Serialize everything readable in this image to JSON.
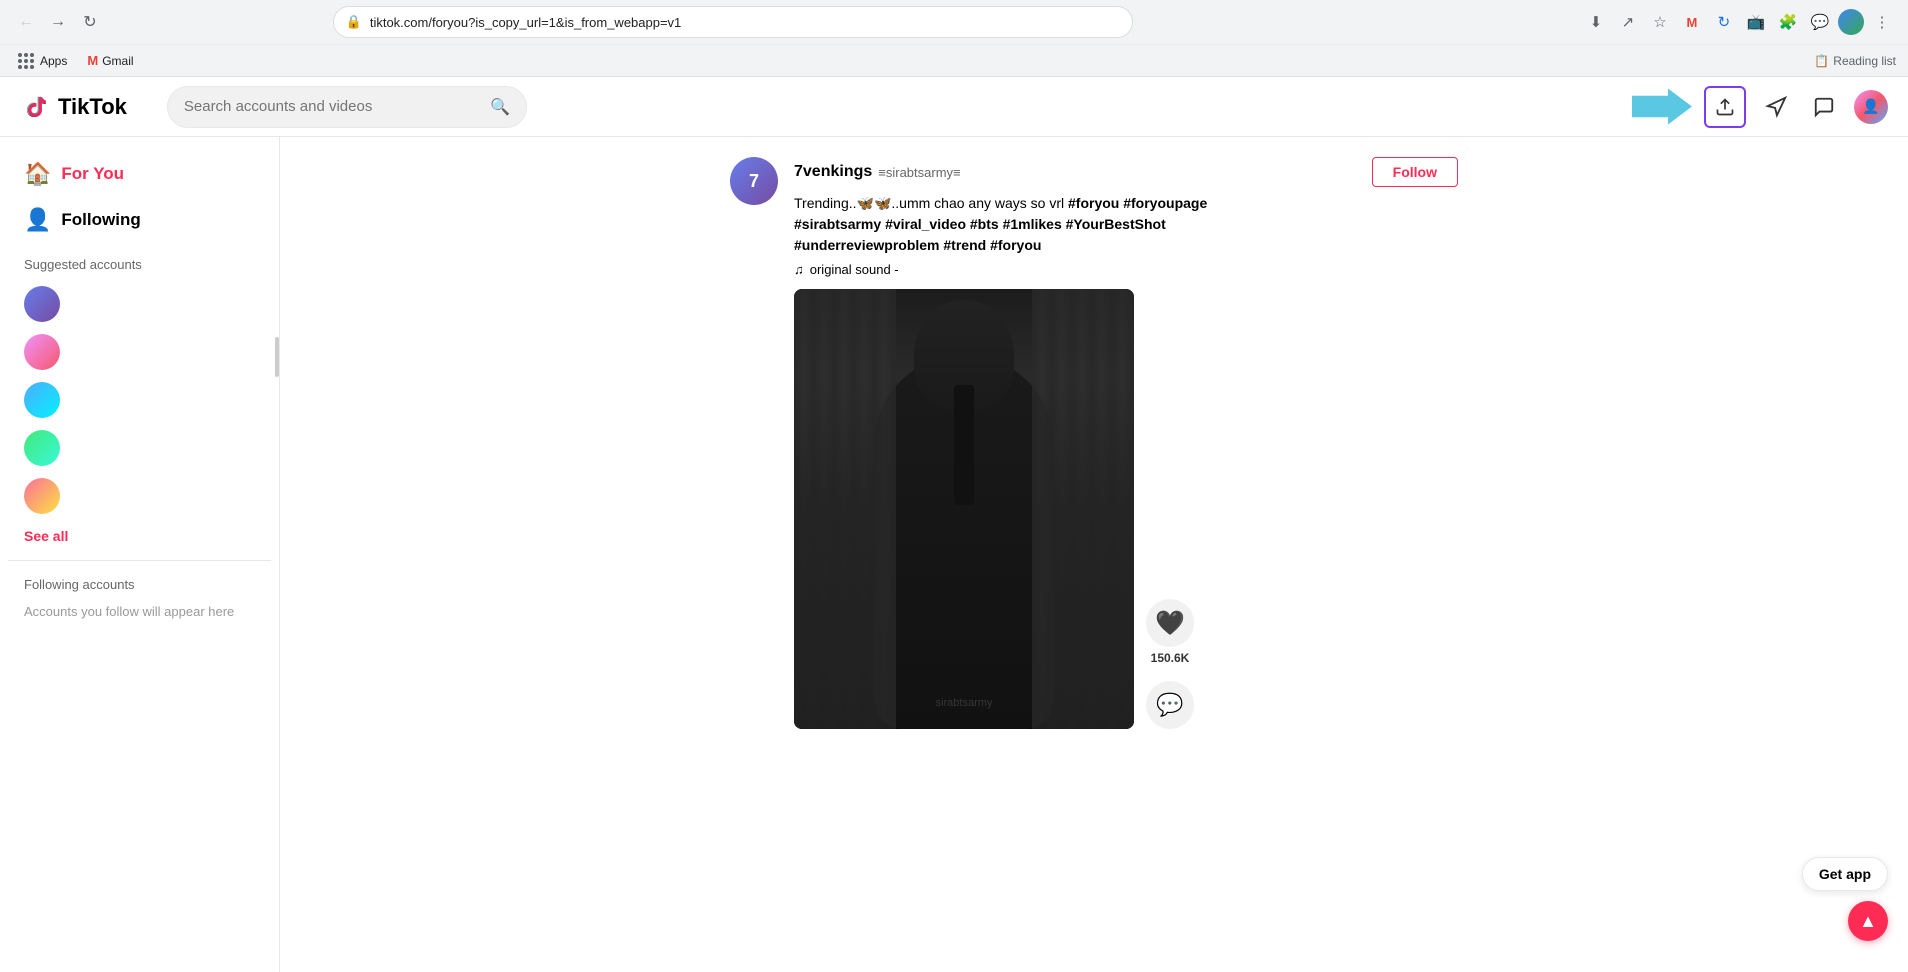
{
  "browser": {
    "url": "tiktok.com/foryou?is_copy_url=1&is_from_webapp=v1",
    "back_disabled": false,
    "forward_disabled": false,
    "bookmarks": [
      {
        "label": "Apps",
        "icon": "apps-icon"
      },
      {
        "label": "Gmail",
        "icon": "gmail-icon"
      }
    ],
    "reading_list_label": "Reading list"
  },
  "header": {
    "logo_text": "TikTok",
    "search_placeholder": "Search accounts and videos",
    "upload_tooltip": "Upload",
    "inbox_tooltip": "Inbox",
    "profile_tooltip": "Profile"
  },
  "sidebar": {
    "nav_items": [
      {
        "label": "For You",
        "active": true,
        "icon": "home"
      },
      {
        "label": "Following",
        "active": false,
        "icon": "people"
      }
    ],
    "suggested_accounts_title": "Suggested accounts",
    "accounts": [
      {
        "id": "acc1",
        "color_class": "av1"
      },
      {
        "id": "acc2",
        "color_class": "av2"
      },
      {
        "id": "acc3",
        "color_class": "av3"
      },
      {
        "id": "acc4",
        "color_class": "av4"
      },
      {
        "id": "acc5",
        "color_class": "av5"
      }
    ],
    "see_all_label": "See all",
    "following_accounts_title": "Following accounts",
    "following_empty_label": "Accounts you follow will appear here"
  },
  "feed": {
    "video": {
      "author_name": "7venkings",
      "author_handle": "≡sirabtsarmy≡",
      "description": "Trending..🦋🦋..umm chao any ways so vrl #foryou #foryoupage #sirabtsarmy #viral_video #bts #1mlikes #YourBestShot #underreviewproblem #trend #foryou",
      "sound_label": "original sound -",
      "follow_label": "Follow",
      "likes_count": "150.6K",
      "comments_label": "Comments",
      "overlay_text": "sirabtsarmy"
    }
  },
  "floating": {
    "get_app_label": "Get app"
  }
}
